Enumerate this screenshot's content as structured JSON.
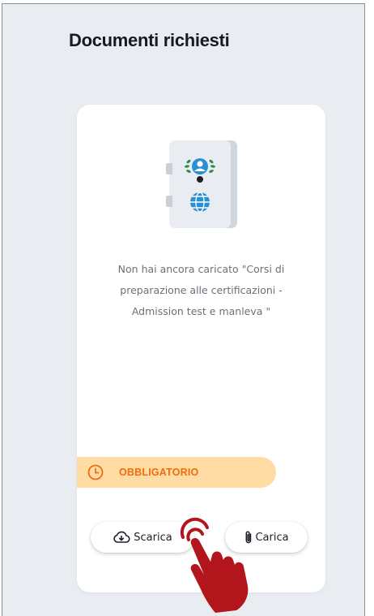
{
  "header": {
    "title": "Documenti richiesti"
  },
  "card": {
    "illustration_icon": "passport-document-icon",
    "message": "Non hai ancora caricato \"Corsi di preparazione alle certificazioni - Admission test e manleva \"",
    "badge": {
      "icon": "clock-icon",
      "label": "OBBLIGATORIO",
      "background_color": "#ffdca4",
      "text_color": "#ef6c10"
    },
    "buttons": {
      "download": {
        "icon": "cloud-download-icon",
        "label": "Scarica"
      },
      "upload": {
        "icon": "paperclip-icon",
        "label": "Carica"
      }
    }
  },
  "overlay": {
    "cursor_icon": "hand-pointer-icon",
    "cursor_color": "#b3151c"
  }
}
